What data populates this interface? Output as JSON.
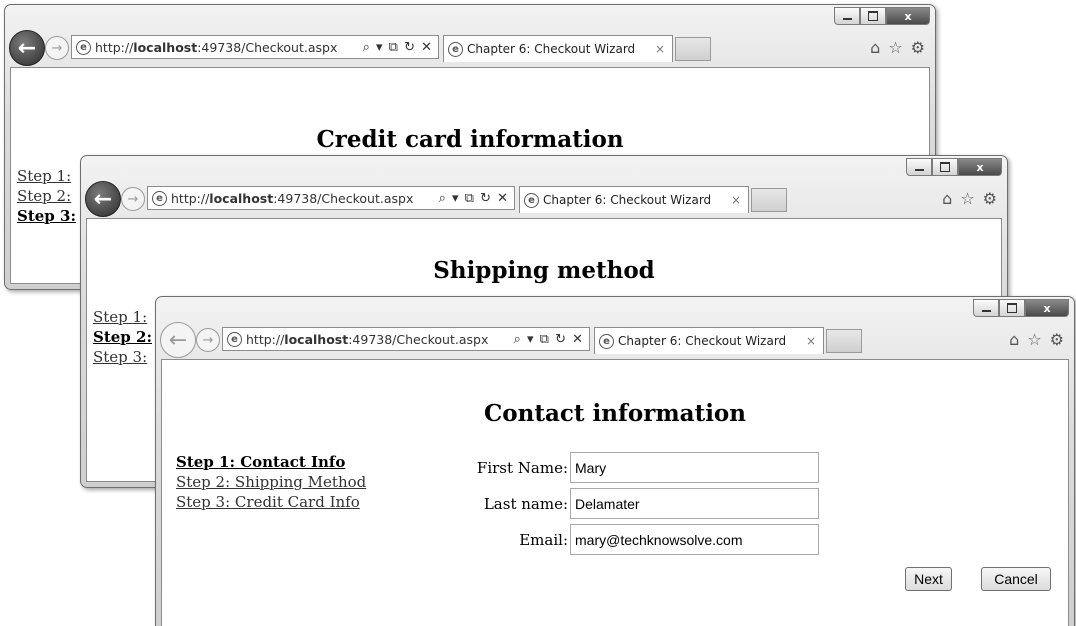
{
  "browser": {
    "url_prefix": "http://",
    "url_host": "localhost",
    "url_rest": ":49738/Checkout.aspx",
    "address_tools": "⌕ ▾ ⧉ ↻ ✕",
    "tab_title": "Chapter 6: Checkout Wizard",
    "tab_close": "×",
    "back_glyph": "←",
    "forward_glyph": "→",
    "home_glyph": "⌂",
    "favorites_glyph": "☆",
    "tools_glyph": "⚙",
    "minimize_glyph": "",
    "close_glyph": "x"
  },
  "icons": {
    "back": "back-arrow-icon",
    "forward": "forward-arrow-icon",
    "ie": "ie-logo-icon",
    "home": "home-icon",
    "favorites": "star-icon",
    "tools": "gear-icon"
  },
  "window1": {
    "heading": "Credit card information",
    "steps": [
      "Step 1:",
      "Step 2:",
      "Step 3:"
    ]
  },
  "window2": {
    "heading": "Shipping method",
    "steps": [
      "Step 1:",
      "Step 2:",
      "Step 3:"
    ]
  },
  "window3": {
    "heading": "Contact information",
    "steps": [
      "Step 1: Contact Info",
      "Step 2: Shipping Method",
      "Step 3: Credit Card Info"
    ],
    "form": {
      "first_name_label": "First Name:",
      "first_name_value": "Mary",
      "last_name_label": "Last name:",
      "last_name_value": "Delamater",
      "email_label": "Email:",
      "email_value": "mary@techknowsolve.com"
    },
    "next_label": "Next",
    "cancel_label": "Cancel"
  }
}
